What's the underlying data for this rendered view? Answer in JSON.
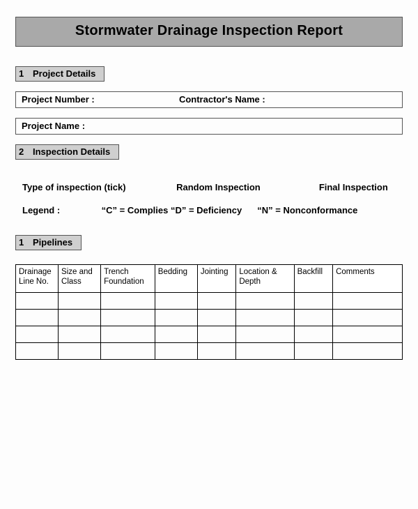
{
  "title": "Stormwater Drainage Inspection Report",
  "sections": {
    "project": {
      "num": "1",
      "label": "Project Details"
    },
    "inspection": {
      "num": "2",
      "label": "Inspection Details"
    },
    "pipelines": {
      "num": "1",
      "label": "Pipelines"
    }
  },
  "fields": {
    "project_number_label": "Project Number :",
    "contractor_name_label": "Contractor's Name :",
    "project_name_label": "Project Name :"
  },
  "inspection_type": {
    "prompt": "Type of inspection (tick)",
    "option_random": "Random Inspection",
    "option_final": "Final Inspection"
  },
  "legend": {
    "label": "Legend   :",
    "cd": "“C” = Complies “D” = Deficiency",
    "n": "“N” = Nonconformance"
  },
  "table": {
    "headers": [
      "Drainage Line No.",
      "Size and Class",
      "Trench Foundation",
      "Bedding",
      "Jointing",
      "Location & Depth",
      "Backfill",
      "Comments"
    ],
    "rows": [
      [
        "",
        "",
        "",
        "",
        "",
        "",
        "",
        ""
      ],
      [
        "",
        "",
        "",
        "",
        "",
        "",
        "",
        ""
      ],
      [
        "",
        "",
        "",
        "",
        "",
        "",
        "",
        ""
      ],
      [
        "",
        "",
        "",
        "",
        "",
        "",
        "",
        ""
      ]
    ]
  }
}
